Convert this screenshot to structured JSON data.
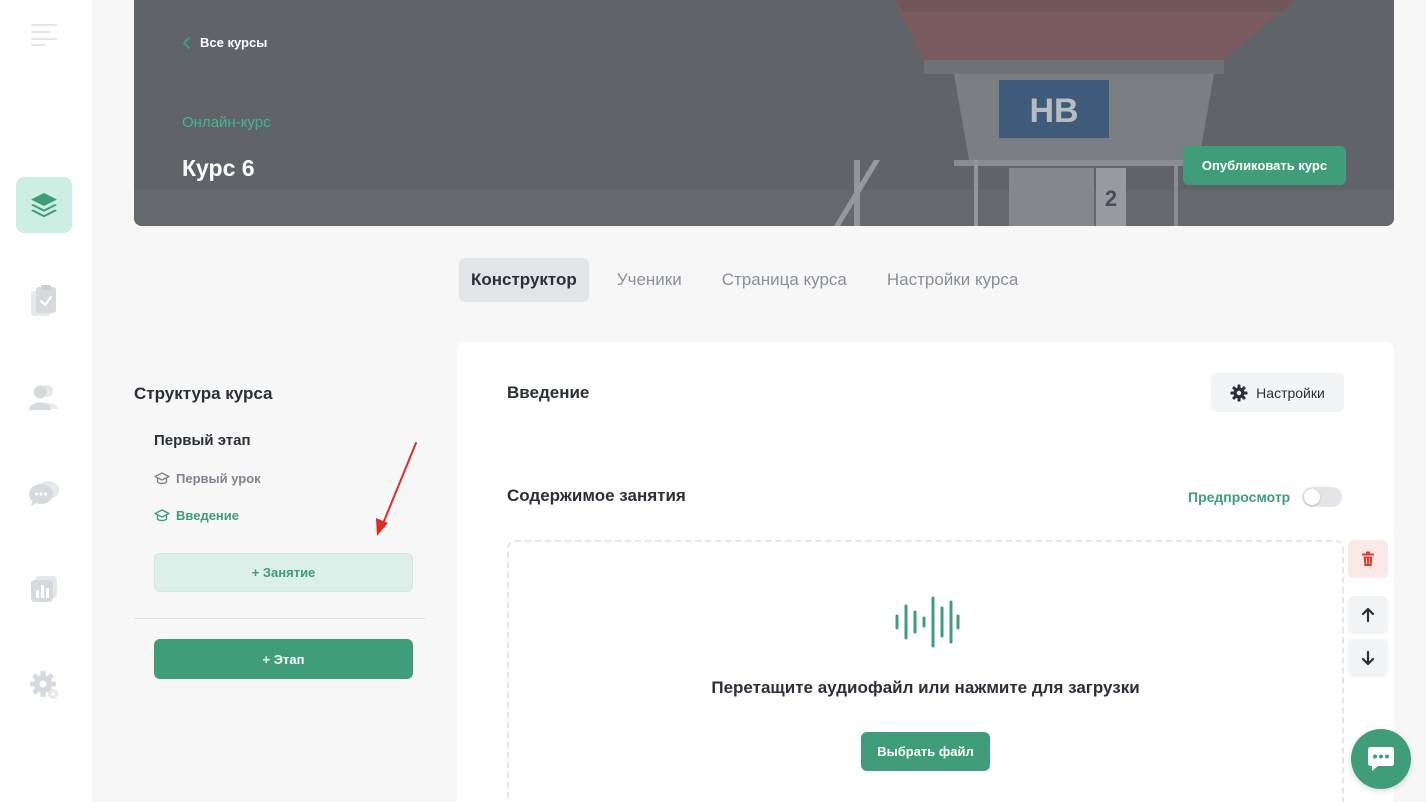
{
  "sidebar": {
    "items": [
      {
        "icon": "courses-stack-icon",
        "active": true
      },
      {
        "icon": "tasks-clipboard-icon",
        "active": false
      },
      {
        "icon": "users-icon",
        "active": false
      },
      {
        "icon": "chat-bubbles-icon",
        "active": false
      },
      {
        "icon": "analytics-chart-icon",
        "active": false
      },
      {
        "icon": "settings-gear-icon",
        "active": false
      }
    ]
  },
  "hero": {
    "back_label": "Все курсы",
    "subtitle": "Онлайн-курс",
    "title": "Курс 6",
    "publish_label": "Опубликовать курс"
  },
  "tabs": [
    {
      "label": "Конструктор",
      "active": true
    },
    {
      "label": "Ученики",
      "active": false
    },
    {
      "label": "Страница курса",
      "active": false
    },
    {
      "label": "Настройки курса",
      "active": false
    }
  ],
  "structure": {
    "title": "Структура курса",
    "stage": "Первый этап",
    "lessons": [
      {
        "label": "Первый урок",
        "active": false
      },
      {
        "label": "Введение",
        "active": true
      }
    ],
    "add_lesson_label": "+ Занятие",
    "add_stage_label": "+ Этап"
  },
  "lesson": {
    "title": "Введение",
    "settings_label": "Настройки",
    "content_title": "Содержимое занятия",
    "preview_label": "Предпросмотр",
    "preview_enabled": false,
    "drop_text": "Перетащите аудиофайл или нажмите для загрузки",
    "choose_file_label": "Выбрать файл"
  },
  "colors": {
    "accent": "#3f9d79",
    "accent_light": "#dcefe9",
    "danger": "#e03b3b",
    "arrow": "#e02a2a"
  }
}
